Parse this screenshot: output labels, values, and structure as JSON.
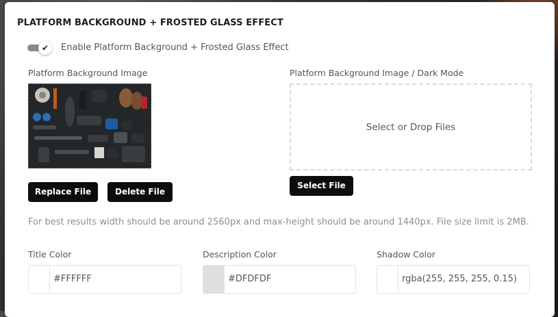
{
  "section": {
    "title": "PLATFORM BACKGROUND + FROSTED GLASS EFFECT"
  },
  "toggle": {
    "label": "Enable Platform Background + Frosted Glass Effect",
    "checked": true,
    "icon": "check-icon"
  },
  "bg_image": {
    "label": "Platform Background Image",
    "replace_label": "Replace File",
    "delete_label": "Delete File"
  },
  "dark_image": {
    "label": "Platform Background Image / Dark Mode",
    "drop_label": "Select or Drop Files",
    "select_label": "Select File"
  },
  "help_text": "For best results width should be around 2560px and max-height should be around 1440px. File size limit is 2MB.",
  "colors": {
    "title": {
      "label": "Title Color",
      "value": "#FFFFFF",
      "swatch": "#FFFFFF"
    },
    "description": {
      "label": "Description Color",
      "value": "#DFDFDF",
      "swatch": "#DFDFDF"
    },
    "shadow": {
      "label": "Shadow Color",
      "value": "rgba(255, 255, 255, 0.15)",
      "swatch": "rgba(255, 255, 255, 0.15)"
    }
  }
}
